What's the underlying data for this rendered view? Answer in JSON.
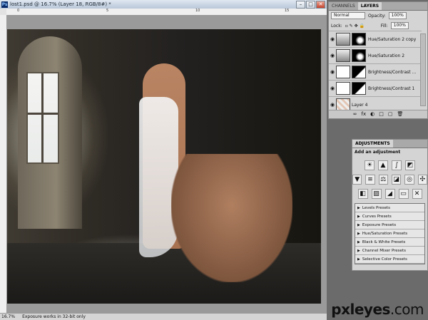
{
  "window": {
    "title": "lost1.psd @ 16.7% (Layer 18, RGB/8#) *",
    "ps_label": "Ps",
    "buttons": [
      "–",
      "□",
      "✕"
    ]
  },
  "ruler": {
    "ticks": [
      "0",
      "5",
      "10",
      "15"
    ]
  },
  "statusbar": {
    "zoom": "16.7%",
    "text": "Exposure works in 32-bit only"
  },
  "layers_panel": {
    "tabs": [
      "CHANNELS",
      "LAYERS"
    ],
    "blend_mode": "Normal",
    "opacity_label": "Opacity:",
    "opacity_value": "100%",
    "fill_label": "Fill:",
    "fill_value": "100%",
    "lock_label": "Lock:",
    "layers": [
      {
        "name": "Hue/Saturation 2 copy"
      },
      {
        "name": "Hue/Saturation 2"
      },
      {
        "name": "Brightness/Contrast ..."
      },
      {
        "name": "Brightness/Contrast 1"
      },
      {
        "name": "Layer 4"
      }
    ],
    "bottom_icons": [
      "fx",
      "◐",
      "□",
      "▢",
      "🗑"
    ]
  },
  "adjustments_panel": {
    "tab": "ADJUSTMENTS",
    "heading": "Add an adjustment",
    "presets": [
      "Levels Presets",
      "Curves Presets",
      "Exposure Presets",
      "Hue/Saturation Presets",
      "Black & White Presets",
      "Channel Mixer Presets",
      "Selective Color Presets"
    ]
  },
  "watermark": {
    "brand": "pxleyes",
    "suffix": ".com"
  },
  "colors": {
    "panel_bg": "#d4d4d4",
    "title_bar": "#c9d4e2"
  }
}
